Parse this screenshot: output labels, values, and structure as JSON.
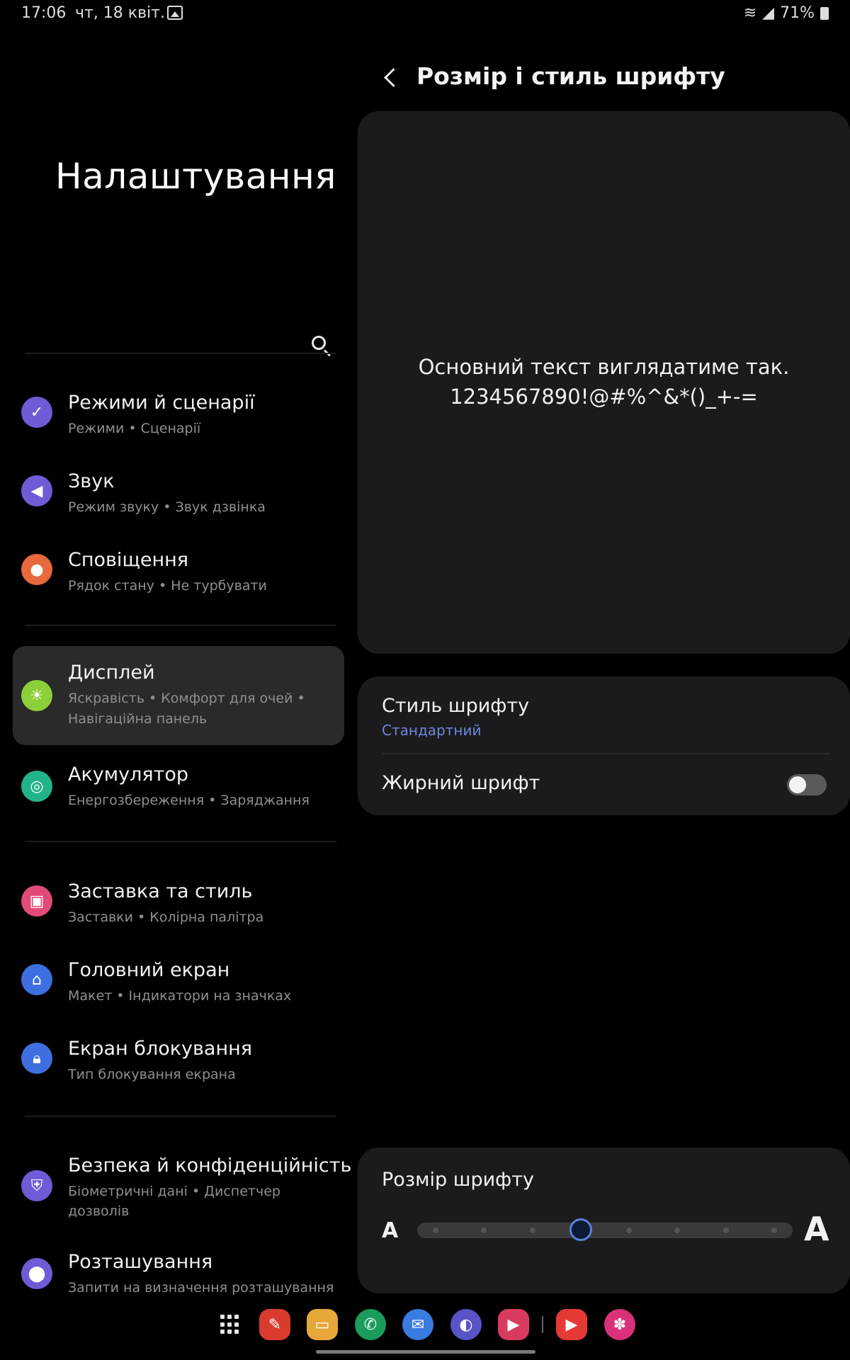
{
  "status_bar": {
    "time": "17:06",
    "date": "чт, 18 квіт.",
    "battery": "71%"
  },
  "left_pane": {
    "title": "Налаштування",
    "items": [
      {
        "title": "Режими й сценарії",
        "subtitle": "Режими • Сценарії",
        "icon": "modes-icon",
        "color": "#6f5bd6"
      },
      {
        "title": "Звук",
        "subtitle": "Режим звуку • Звук дзвінка",
        "icon": "sound-icon",
        "color": "#6f5bd6"
      },
      {
        "title": "Сповіщення",
        "subtitle": "Рядок стану • Не турбувати",
        "icon": "notifications-icon",
        "color": "#e8693b"
      },
      {
        "title": "Дисплей",
        "subtitle": "Яскравість • Комфорт для очей •",
        "subtitle2": "Навігаційна панель",
        "icon": "display-icon",
        "color": "#8ccf3a"
      },
      {
        "title": "Акумулятор",
        "subtitle": "Енергозбереження • Заряджання",
        "icon": "battery-icon",
        "color": "#22b38a"
      },
      {
        "title": "Заставка та стиль",
        "subtitle": "Заставки • Колірна палітра",
        "icon": "wallpaper-icon",
        "color": "#e34a78"
      },
      {
        "title": "Головний екран",
        "subtitle": "Макет • Індикатори на значках",
        "icon": "home-icon",
        "color": "#3d6fe0"
      },
      {
        "title": "Екран блокування",
        "subtitle": "Тип блокування екрана",
        "icon": "lock-icon",
        "color": "#3d6fe0"
      },
      {
        "title": "Безпека й конфіденційність",
        "subtitle": "Біометричні дані • Диспетчер",
        "subtitle2": "дозволів",
        "icon": "shield-icon",
        "color": "#6f5bd6"
      },
      {
        "title": "Розташування",
        "subtitle": "Запити на визначення розташування",
        "icon": "location-icon",
        "color": "#6f5bd6"
      }
    ]
  },
  "right_pane": {
    "title": "Розмір і стиль шрифту",
    "preview_line1": "Основний текст виглядатиме так.",
    "preview_line2": "1234567890!@#%^&*()_+-=",
    "font_style_label": "Стиль шрифту",
    "font_style_value": "Стандартний",
    "bold_font_label": "Жирний шрифт",
    "bold_font_enabled": false,
    "font_size_label": "Розмір шрифту",
    "font_size_small_glyph": "A",
    "font_size_large_glyph": "A",
    "font_size_steps": 8,
    "font_size_level": 4,
    "accent_color": "#5a7fd6"
  },
  "dock": {
    "apps": [
      {
        "name": "apps-grid-icon"
      },
      {
        "name": "notes-app-icon",
        "color": "#d93b2f"
      },
      {
        "name": "files-app-icon",
        "color": "#e7a83a"
      },
      {
        "name": "phone-app-icon",
        "color": "#1a9c5c"
      },
      {
        "name": "messages-app-icon",
        "color": "#3a7be0"
      },
      {
        "name": "internet-app-icon",
        "color": "#5a52c7"
      },
      {
        "name": "screen-recorder-app-icon",
        "color": "#d93b5f"
      },
      {
        "name": "youtube-app-icon",
        "color": "#e53935"
      },
      {
        "name": "bixby-app-icon",
        "color": "#d9317a"
      }
    ]
  }
}
